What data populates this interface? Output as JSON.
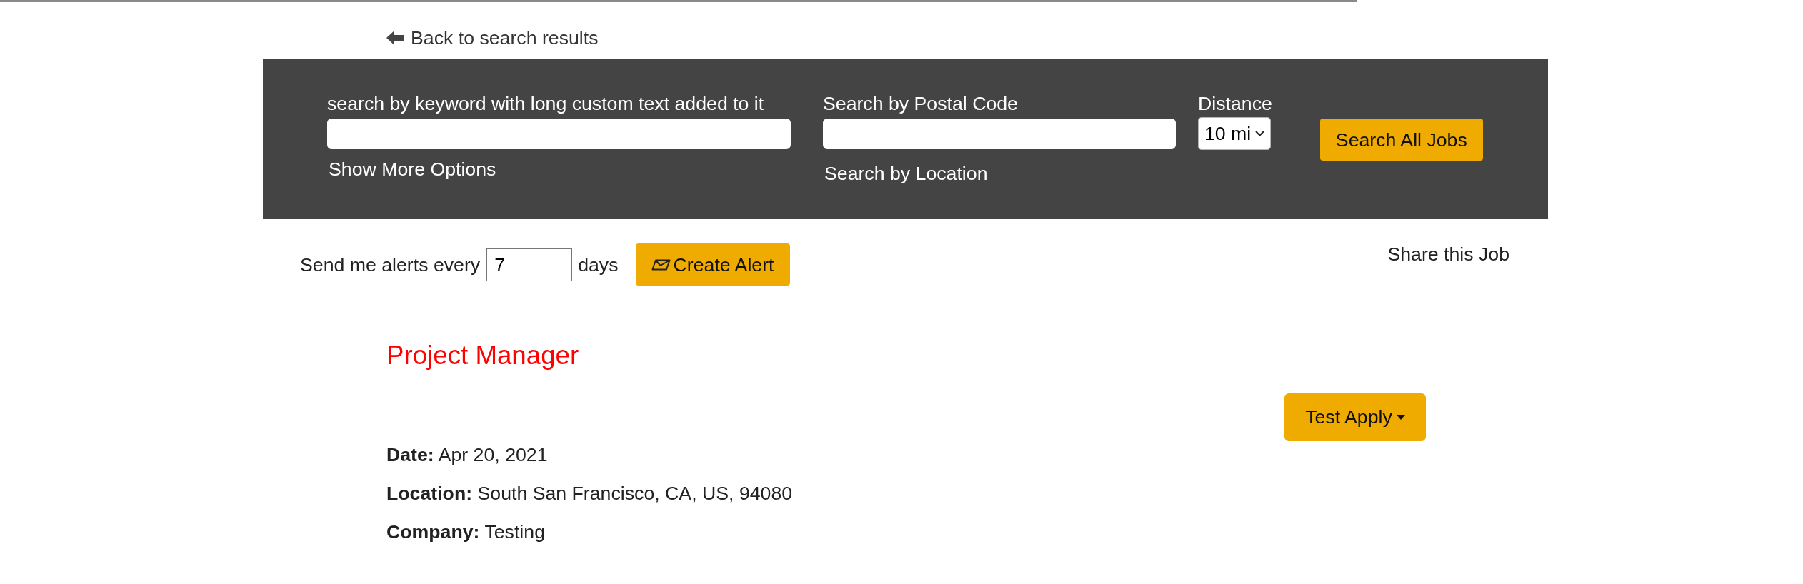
{
  "back_link": {
    "label": "Back to search results"
  },
  "search_panel": {
    "keyword": {
      "label": "search by keyword with long custom text added to it"
    },
    "show_more_options": "Show More Options",
    "postal_code": {
      "label": "Search by Postal Code"
    },
    "search_by_location": "Search by Location",
    "distance": {
      "label": "Distance",
      "value": "10 mi"
    },
    "search_button": "Search All Jobs"
  },
  "alerts": {
    "prefix": "Send me alerts every",
    "value": "7",
    "suffix": "days",
    "button": "Create Alert"
  },
  "share": "Share this Job",
  "job": {
    "title": "Project Manager",
    "apply_button": "Test Apply",
    "details": [
      "**Date:** Apr 20, 2021",
      "**Location:** South San Francisco, CA, US, 94080",
      "**Company:** Testing"
    ]
  }
}
